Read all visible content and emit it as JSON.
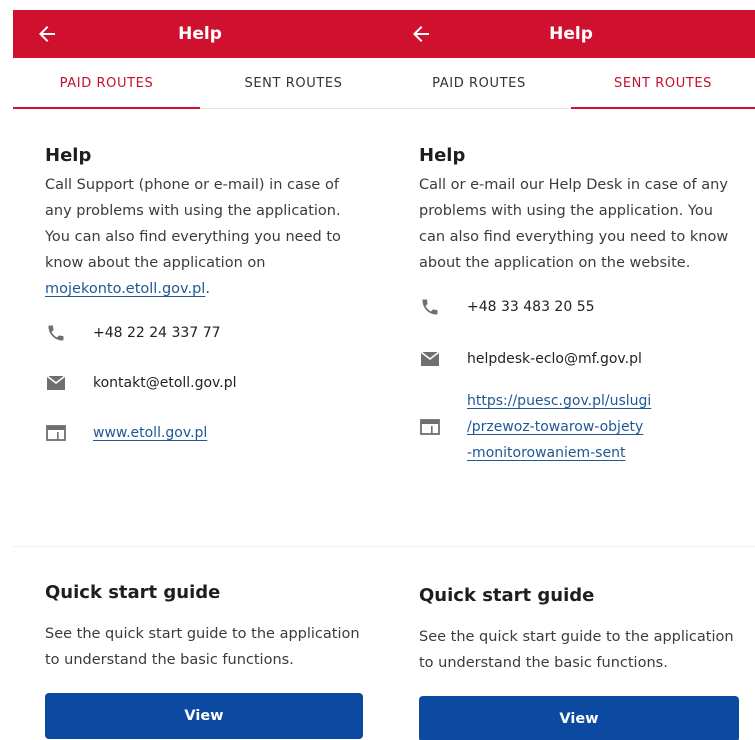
{
  "left": {
    "topbar": {
      "title": "Help"
    },
    "tabs": [
      {
        "label": "PAID ROUTES"
      },
      {
        "label": "SENT ROUTES"
      }
    ],
    "active_tab": 0,
    "help": {
      "title": "Help",
      "description": "Call Support (phone or e-mail) in case of any problems with using the application. You can also find everything you need to know about the application on",
      "link": "mojekonto.etoll.gov.pl",
      "trailing": "."
    },
    "contacts": {
      "phone": "+48 22 24 337 77",
      "email": "kontakt@etoll.gov.pl",
      "website": "www.etoll.gov.pl"
    },
    "guide": {
      "title": "Quick start guide",
      "description": "See the quick start guide to the application to understand the basic functions.",
      "button": "View"
    }
  },
  "right": {
    "topbar": {
      "title": "Help"
    },
    "tabs": [
      {
        "label": "PAID ROUTES"
      },
      {
        "label": "SENT ROUTES"
      }
    ],
    "active_tab": 1,
    "help": {
      "title": "Help",
      "description": "Call or e-mail our Help Desk in case of any problems with using the application. You can also find everything you need to know about the application on the website."
    },
    "contacts": {
      "phone": "+48 33 483 20 55",
      "email": "helpdesk-eclo@mf.gov.pl",
      "website_lines": [
        "https://puesc.gov.pl/uslugi",
        "/przewoz-towarow-objety",
        "-monitorowaniem-sent"
      ]
    },
    "guide": {
      "title": "Quick start guide",
      "description": "See the quick start guide to the application to understand the basic functions.",
      "button": "View"
    }
  },
  "colors": {
    "brand_red": "#d0102f",
    "primary_blue": "#0c4aa2",
    "link_blue": "#1f5796"
  },
  "icons": {
    "back": "arrow-left-icon",
    "phone": "phone-icon",
    "email": "mail-icon",
    "website": "browser-window-icon"
  }
}
